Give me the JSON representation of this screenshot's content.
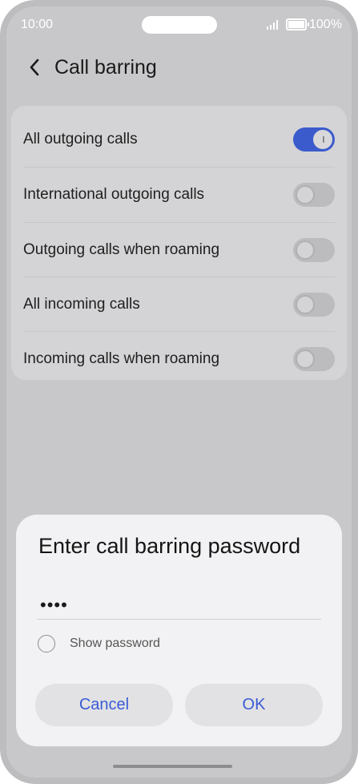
{
  "status_bar": {
    "time": "10:00",
    "battery": "100%"
  },
  "header": {
    "title": "Call barring",
    "back_icon": "chevron-left-icon"
  },
  "settings": {
    "items": [
      {
        "label": "All outgoing calls",
        "enabled": true
      },
      {
        "label": "International outgoing calls",
        "enabled": false
      },
      {
        "label": "Outgoing calls when roaming",
        "enabled": false
      },
      {
        "label": "All incoming calls",
        "enabled": false
      },
      {
        "label": "Incoming calls when roaming",
        "enabled": false
      }
    ]
  },
  "dialog": {
    "title": "Enter call barring password",
    "password_value": "••••",
    "show_password_label": "Show password",
    "show_password_checked": false,
    "cancel_label": "Cancel",
    "ok_label": "OK"
  },
  "colors": {
    "accent": "#3b5bcc",
    "button_text": "#3a5bd6"
  }
}
